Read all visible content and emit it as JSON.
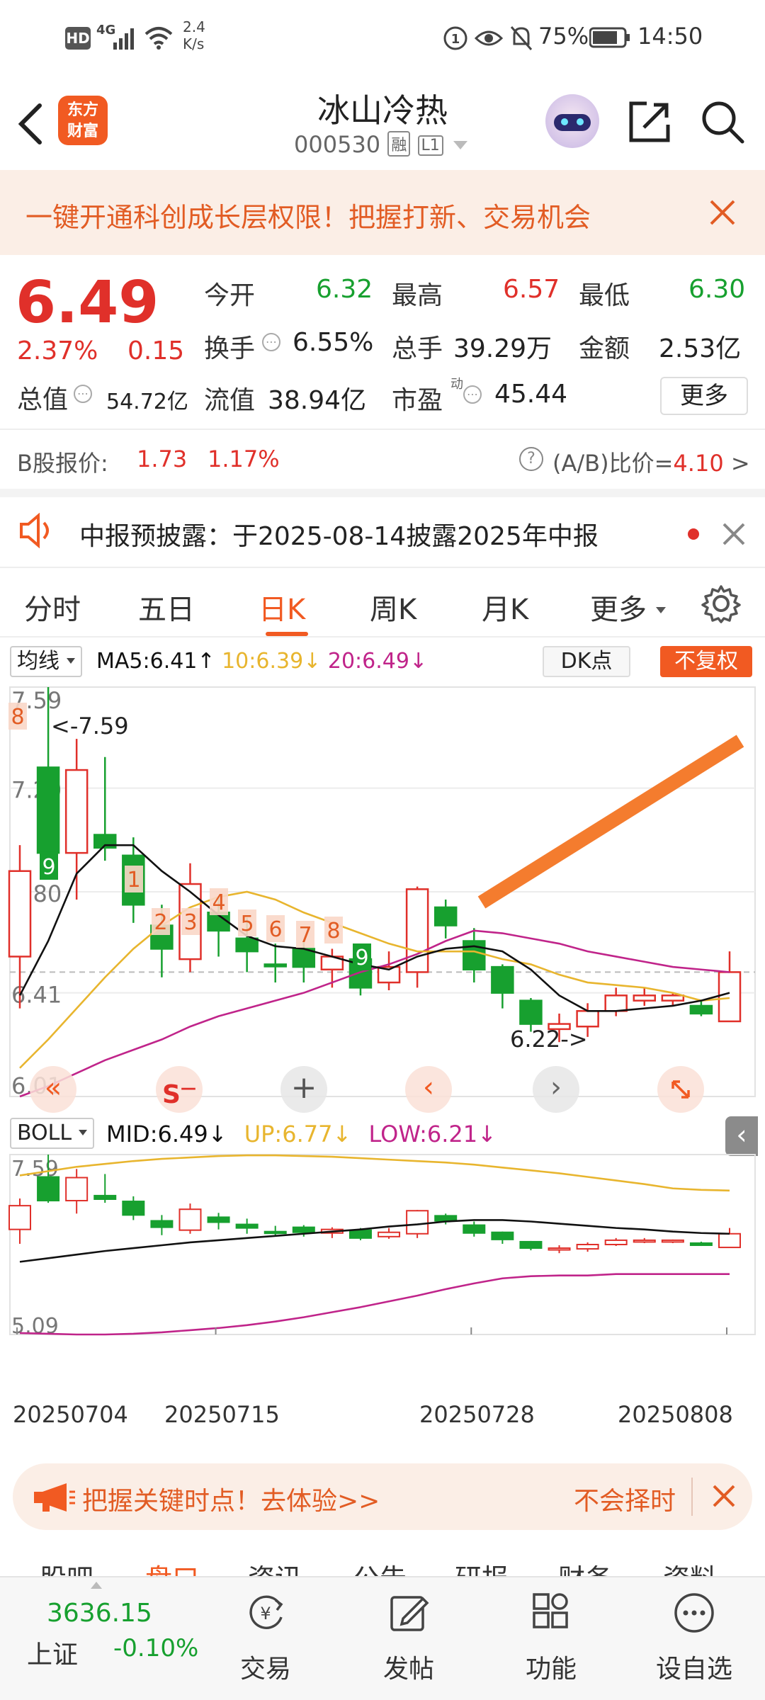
{
  "status_bar": {
    "hd": "HD",
    "network": "4G",
    "speed_value": "2.4",
    "speed_unit": "K/s",
    "battery": "75%",
    "time": "14:50"
  },
  "header": {
    "logo_text_1": "东方",
    "logo_text_2": "财富",
    "stock_name": "冰山冷热",
    "stock_code": "000530",
    "badge_margin": "融",
    "badge_level": "L1"
  },
  "promo": {
    "text": "一键开通科创成长层权限！把握打新、交易机会"
  },
  "quote": {
    "price": "6.49",
    "change_pct": "2.37%",
    "change": "0.15",
    "open_label": "今开",
    "open": "6.32",
    "high_label": "最高",
    "high": "6.57",
    "low_label": "最低",
    "low": "6.30",
    "turnover_label": "换手",
    "turnover": "6.55%",
    "volume_label": "总手",
    "volume": "39.29万",
    "amount_label": "金额",
    "amount": "2.53亿",
    "mktcap_label": "总值",
    "mktcap": "54.72亿",
    "float_label": "流值",
    "float_cap": "38.94亿",
    "pe_label": "市盈",
    "pe_sup": "动",
    "pe": "45.44",
    "more_button": "更多"
  },
  "bshare": {
    "label": "B股报价:",
    "price": "1.73",
    "pct": "1.17%",
    "ratio_label": "(A/B)比价=",
    "ratio": "4.10",
    "arrow": ">"
  },
  "notice": {
    "text": "中报预披露：于2025-08-14披露2025年中报"
  },
  "tabs": [
    "分时",
    "五日",
    "日K",
    "周K",
    "月K",
    "更多"
  ],
  "active_tab": 2,
  "indicator_bar": {
    "selector": "均线",
    "ma5": "MA5:6.41",
    "ma10": "10:6.39",
    "ma20": "20:6.49",
    "dk_button": "DK点",
    "adj_button": "不复权"
  },
  "chart_data": {
    "type": "candlestick",
    "y_labels": [
      "7.59",
      "7.20",
      "6.80",
      "6.41",
      "6.01"
    ],
    "ylim": [
      6.01,
      7.59
    ],
    "dashed_line": 6.49,
    "annot_high": "<-7.59",
    "annot_low": "6.22->",
    "seq_labels": [
      "8",
      "9",
      "1",
      "2",
      "3",
      "4",
      "5",
      "6",
      "7",
      "8",
      "9"
    ],
    "candles": [
      {
        "o": 6.55,
        "c": 6.88,
        "h": 6.98,
        "l": 6.35,
        "up": true
      },
      {
        "o": 6.95,
        "c": 7.28,
        "h": 7.59,
        "l": 6.92,
        "up": false
      },
      {
        "o": 6.95,
        "c": 7.27,
        "h": 7.39,
        "l": 6.77,
        "up": true
      },
      {
        "o": 7.02,
        "c": 6.97,
        "h": 7.32,
        "l": 6.92,
        "up": false
      },
      {
        "o": 6.94,
        "c": 6.75,
        "h": 7.01,
        "l": 6.68,
        "up": false
      },
      {
        "o": 6.67,
        "c": 6.58,
        "h": 6.75,
        "l": 6.47,
        "up": false
      },
      {
        "o": 6.54,
        "c": 6.83,
        "h": 6.91,
        "l": 6.49,
        "up": true
      },
      {
        "o": 6.72,
        "c": 6.65,
        "h": 6.78,
        "l": 6.55,
        "up": false
      },
      {
        "o": 6.62,
        "c": 6.57,
        "h": 6.7,
        "l": 6.49,
        "up": false
      },
      {
        "o": 6.52,
        "c": 6.52,
        "h": 6.6,
        "l": 6.45,
        "up": false
      },
      {
        "o": 6.58,
        "c": 6.51,
        "h": 6.61,
        "l": 6.45,
        "up": false
      },
      {
        "o": 6.5,
        "c": 6.55,
        "h": 6.58,
        "l": 6.43,
        "up": true
      },
      {
        "o": 6.54,
        "c": 6.43,
        "h": 6.57,
        "l": 6.4,
        "up": false
      },
      {
        "o": 6.45,
        "c": 6.51,
        "h": 6.57,
        "l": 6.42,
        "up": true
      },
      {
        "o": 6.49,
        "c": 6.81,
        "h": 6.82,
        "l": 6.43,
        "up": true
      },
      {
        "o": 6.74,
        "c": 6.67,
        "h": 6.77,
        "l": 6.62,
        "up": false
      },
      {
        "o": 6.61,
        "c": 6.5,
        "h": 6.66,
        "l": 6.45,
        "up": false
      },
      {
        "o": 6.51,
        "c": 6.41,
        "h": 6.52,
        "l": 6.35,
        "up": false
      },
      {
        "o": 6.38,
        "c": 6.29,
        "h": 6.39,
        "l": 6.26,
        "up": false
      },
      {
        "o": 6.27,
        "c": 6.29,
        "h": 6.33,
        "l": 6.22,
        "up": true
      },
      {
        "o": 6.28,
        "c": 6.34,
        "h": 6.37,
        "l": 6.24,
        "up": true
      },
      {
        "o": 6.34,
        "c": 6.4,
        "h": 6.43,
        "l": 6.32,
        "up": true
      },
      {
        "o": 6.38,
        "c": 6.4,
        "h": 6.43,
        "l": 6.36,
        "up": true
      },
      {
        "o": 6.38,
        "c": 6.4,
        "h": 6.41,
        "l": 6.36,
        "up": true
      },
      {
        "o": 6.36,
        "c": 6.33,
        "h": 6.38,
        "l": 6.32,
        "up": false
      },
      {
        "o": 6.3,
        "c": 6.49,
        "h": 6.57,
        "l": 6.3,
        "up": true
      }
    ],
    "ma5": [
      6.4,
      6.61,
      6.87,
      6.98,
      6.98,
      6.88,
      6.8,
      6.71,
      6.63,
      6.59,
      6.58,
      6.55,
      6.52,
      6.5,
      6.55,
      6.58,
      6.59,
      6.57,
      6.5,
      6.4,
      6.34,
      6.34,
      6.35,
      6.36,
      6.38,
      6.41
    ],
    "ma10": [
      6.12,
      6.23,
      6.35,
      6.47,
      6.58,
      6.67,
      6.74,
      6.78,
      6.8,
      6.77,
      6.72,
      6.68,
      6.64,
      6.6,
      6.57,
      6.57,
      6.57,
      6.54,
      6.52,
      6.48,
      6.45,
      6.44,
      6.43,
      6.41,
      6.38,
      6.39
    ],
    "ma20": [
      6.01,
      6.05,
      6.1,
      6.15,
      6.19,
      6.23,
      6.28,
      6.32,
      6.35,
      6.38,
      6.41,
      6.45,
      6.49,
      6.52,
      6.56,
      6.61,
      6.65,
      6.64,
      6.62,
      6.6,
      6.57,
      6.55,
      6.53,
      6.51,
      6.5,
      6.49
    ]
  },
  "boll": {
    "selector": "BOLL",
    "mid": "MID:6.49",
    "up": "UP:6.77",
    "low": "LOW:6.21",
    "y_top": "7.59",
    "y_bottom": "5.09",
    "ylim": [
      5.09,
      7.59
    ],
    "up_series": [
      7.3,
      7.36,
      7.42,
      7.46,
      7.5,
      7.53,
      7.55,
      7.57,
      7.58,
      7.58,
      7.57,
      7.56,
      7.54,
      7.52,
      7.5,
      7.48,
      7.45,
      7.41,
      7.37,
      7.33,
      7.28,
      7.23,
      7.18,
      7.12,
      7.1,
      7.09
    ],
    "mid_series": [
      6.1,
      6.15,
      6.2,
      6.25,
      6.29,
      6.33,
      6.37,
      6.4,
      6.43,
      6.46,
      6.49,
      6.52,
      6.55,
      6.59,
      6.62,
      6.66,
      6.68,
      6.68,
      6.66,
      6.63,
      6.6,
      6.57,
      6.55,
      6.52,
      6.5,
      6.49
    ],
    "low_series": [
      5.11,
      5.1,
      5.09,
      5.09,
      5.1,
      5.12,
      5.15,
      5.18,
      5.22,
      5.27,
      5.33,
      5.4,
      5.47,
      5.55,
      5.63,
      5.72,
      5.8,
      5.87,
      5.9,
      5.91,
      5.91,
      5.93,
      5.93,
      5.93,
      5.93,
      5.93
    ]
  },
  "dates": [
    "20250704",
    "20250715",
    "20250728",
    "20250808"
  ],
  "ad": {
    "text": "把握关键时点！去体验>>",
    "right_text": "不会择时"
  },
  "subtabs": [
    "股吧",
    "盘口",
    "资讯",
    "公告",
    "研报",
    "财务",
    "资料"
  ],
  "bottom_nav": {
    "index_value": "3636.15",
    "index_name": "上证",
    "index_change": "-0.10%",
    "items": [
      "交易",
      "发帖",
      "功能",
      "设自选"
    ]
  },
  "colors": {
    "up": "#e0302a",
    "down": "#17a02f",
    "ma5": "#111111",
    "ma10": "#e8b52e",
    "ma20": "#c0248a",
    "accent": "#f15a22"
  }
}
